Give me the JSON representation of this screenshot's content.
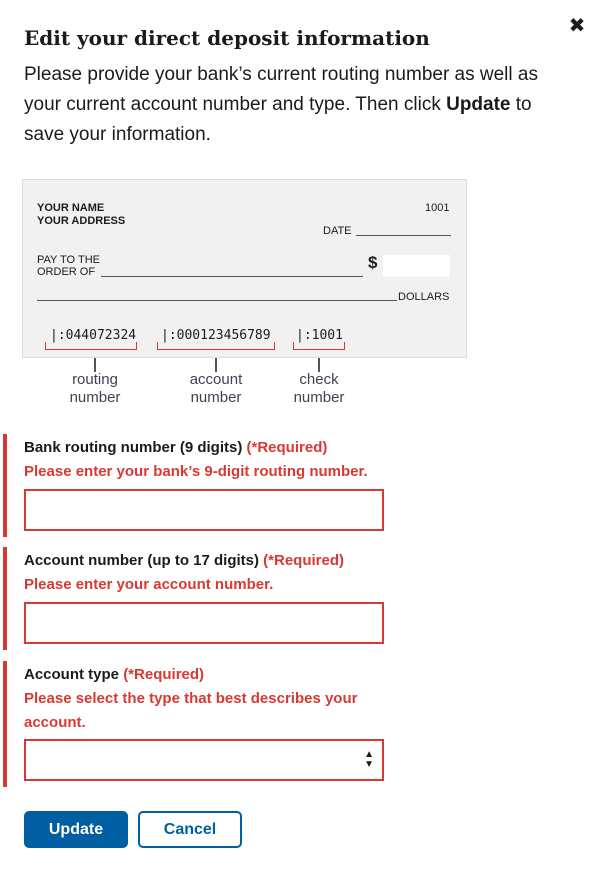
{
  "modal": {
    "close_label": "✖",
    "title": "Edit your direct deposit information",
    "intro_before": "Please provide your bank’s current routing number as well as your current account number and type. Then click ",
    "intro_bold": "Update",
    "intro_after": " to save your information."
  },
  "check": {
    "name": "YOUR NAME",
    "address": "YOUR ADDRESS",
    "number": "1001",
    "date_label": "DATE",
    "pay_to_1": "PAY TO THE",
    "pay_to_2": "ORDER OF",
    "dollar_sign": "$",
    "dollars_label": "DOLLARS",
    "micr_routing": "|:044072324",
    "micr_account": "|:000123456789",
    "micr_check": "|:1001",
    "callout_routing_1": "routing",
    "callout_routing_2": "number",
    "callout_account_1": "account",
    "callout_account_2": "number",
    "callout_check_1": "check",
    "callout_check_2": "number"
  },
  "form": {
    "routing": {
      "label": "Bank routing number (9 digits)",
      "required": "(*Required)",
      "error": "Please enter your bank’s 9-digit routing number.",
      "value": ""
    },
    "account": {
      "label": "Account number  (up to 17 digits)",
      "required": "(*Required)",
      "error": "Please enter your account number.",
      "value": ""
    },
    "type": {
      "label": "Account type",
      "required": "(*Required)",
      "error": "Please select the type that best describes your account.",
      "selected": ""
    }
  },
  "buttons": {
    "update": "Update",
    "cancel": "Cancel"
  },
  "colors": {
    "error": "#d83933",
    "primary": "#005ea2"
  }
}
